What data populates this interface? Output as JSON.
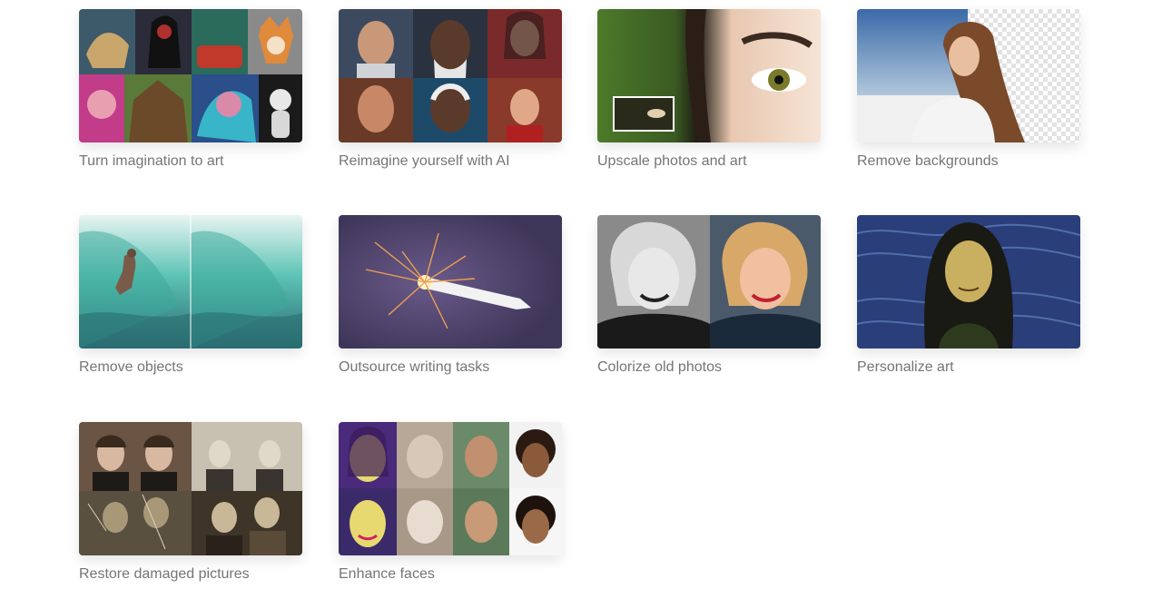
{
  "features": [
    {
      "label": "Turn imagination to art"
    },
    {
      "label": "Reimagine yourself with AI"
    },
    {
      "label": "Upscale photos and art"
    },
    {
      "label": "Remove backgrounds"
    },
    {
      "label": "Remove objects"
    },
    {
      "label": "Outsource writing tasks"
    },
    {
      "label": "Colorize old photos"
    },
    {
      "label": "Personalize art"
    },
    {
      "label": "Restore damaged pictures"
    },
    {
      "label": "Enhance faces"
    }
  ]
}
